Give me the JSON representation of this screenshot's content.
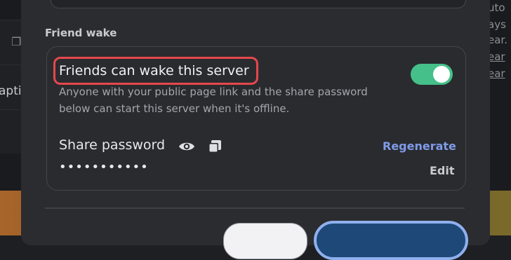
{
  "background": {
    "left_edge_text": "apti",
    "right_edge_lines": [
      "uto",
      "ays",
      "ear.",
      "ear",
      "ear"
    ]
  },
  "friend_wake": {
    "section_label": "Friend wake",
    "toggle_title": "Friends can wake this server",
    "toggle_description": "Anyone with your public page link and the share password below can start this server when it's offline.",
    "toggle_enabled": true,
    "share_password_label": "Share password",
    "regenerate_label": "Regenerate",
    "password_masked": "•••••••••••",
    "edit_label": "Edit"
  },
  "colors": {
    "toggle_on": "#45c08a",
    "link": "#7e9be8",
    "highlight": "#e5484d",
    "primary_button": "#1e4878"
  },
  "icons": {
    "reveal": "eye-icon",
    "copy": "copy-icon"
  }
}
